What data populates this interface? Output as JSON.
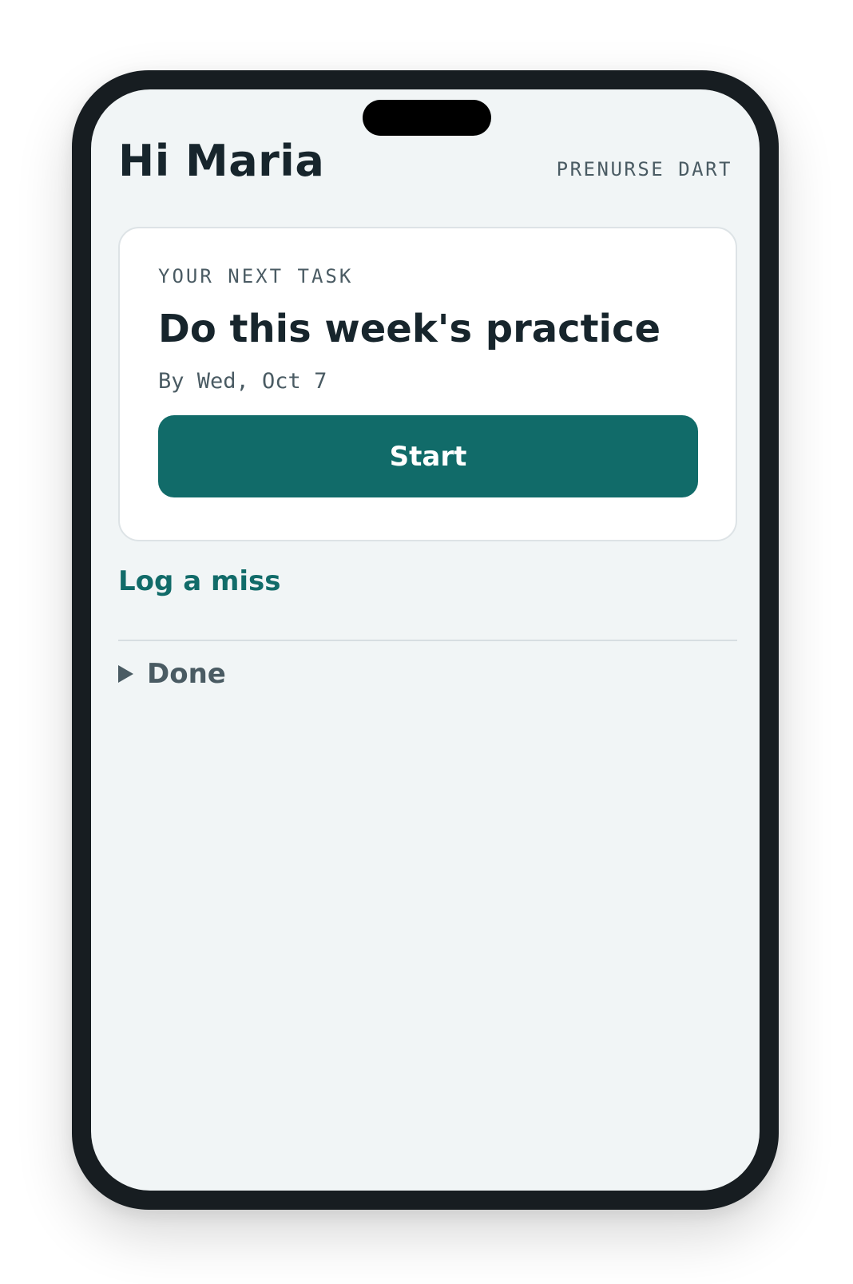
{
  "header": {
    "greeting": "Hi Maria",
    "brand": "PRENURSE DART"
  },
  "next_task": {
    "eyebrow": "YOUR NEXT TASK",
    "title": "Do this week's practice",
    "due": "By Wed, Oct 7",
    "start_label": "Start"
  },
  "actions": {
    "log_miss_label": "Log a miss"
  },
  "done_section": {
    "label": "Done",
    "expanded": false
  },
  "colors": {
    "accent": "#116b69",
    "text_primary": "#17252c",
    "text_secondary": "#4a5b63",
    "screen_bg": "#f1f5f6",
    "device_frame": "#171d21"
  }
}
